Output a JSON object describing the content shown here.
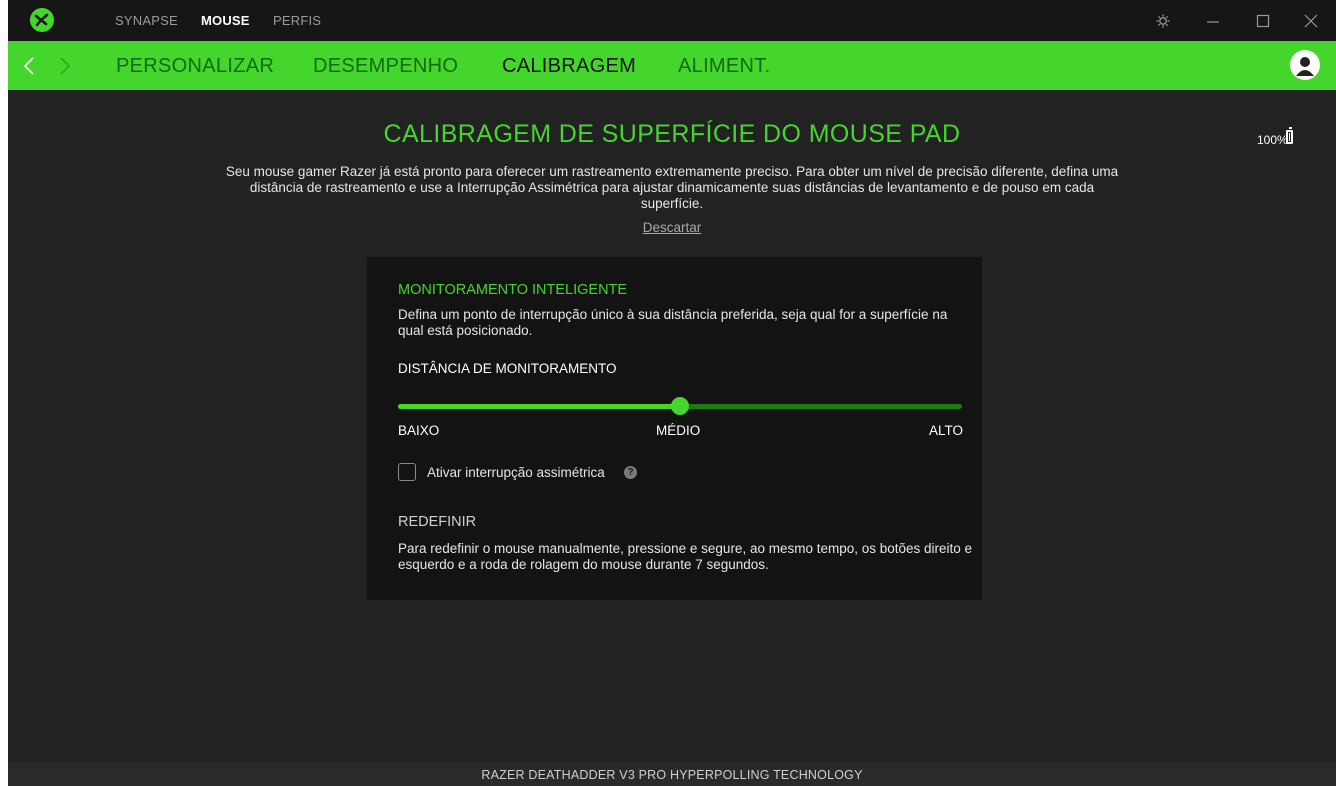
{
  "window": {
    "top_tabs": [
      {
        "label": "SYNAPSE",
        "active": false
      },
      {
        "label": "MOUSE",
        "active": true
      },
      {
        "label": "PERFIS",
        "active": false
      }
    ],
    "controls": [
      "settings-icon",
      "minimize-icon",
      "maximize-icon",
      "close-icon"
    ]
  },
  "nav": {
    "sub_tabs": [
      {
        "label": "PERSONALIZAR",
        "active": false
      },
      {
        "label": "DESEMPENHO",
        "active": false
      },
      {
        "label": "CALIBRAGEM",
        "active": true
      },
      {
        "label": "ALIMENT.",
        "active": false
      }
    ]
  },
  "main": {
    "title": "CALIBRAGEM DE SUPERFÍCIE DO MOUSE PAD",
    "battery": "100%",
    "description": "Seu mouse gamer Razer já está pronto para oferecer um rastreamento extremamente preciso. Para obter um nível de precisão diferente, defina uma distância de rastreamento e use a Interrupção Assimétrica para ajustar dinamicamente suas distâncias de levantamento e de pouso em cada superfície.",
    "discard": "Descartar"
  },
  "panel": {
    "smart_heading": "MONITORAMENTO INTELIGENTE",
    "smart_text": "Defina um ponto de interrupção único à sua distância preferida, seja qual for a superfície na qual está posicionado.",
    "distance_label": "DISTÂNCIA DE MONITORAMENTO",
    "slider": {
      "value": 0.5,
      "low": "BAIXO",
      "mid": "MÉDIO",
      "high": "ALTO"
    },
    "checkbox_label": "Ativar interrupção assimétrica",
    "checkbox_checked": false,
    "help": "?",
    "reset_heading": "REDEFINIR",
    "reset_text": "Para redefinir o mouse manualmente, pressione e segure, ao mesmo tempo, os botões direito e esquerdo e a roda de rolagem do mouse durante 7 segundos."
  },
  "footer": {
    "device": "RAZER DEATHADDER V3 PRO HYPERPOLLING TECHNOLOGY"
  },
  "colors": {
    "accent": "#44d62c",
    "background": "#222222",
    "panel": "#131313"
  }
}
